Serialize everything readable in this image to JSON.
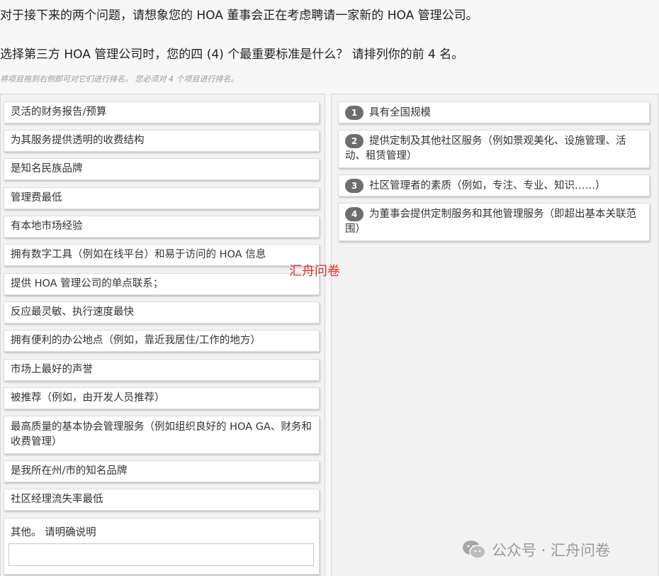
{
  "intro": "对于接下来的两个问题，请想象您的 HOA 董事会正在考虑聘请一家新的 HOA 管理公司。",
  "question": "选择第三方 HOA 管理公司时，您的四 (4) 个最重要标准是什么？   请排列你的前 4 名。",
  "instruction": "将项目拖到右侧即可对它们进行排名。 您必须对 4 个项目进行排名。",
  "available_items": [
    {
      "label": "灵活的财务报告/预算"
    },
    {
      "label": "为其服务提供透明的收费结构"
    },
    {
      "label": "是知名民族品牌"
    },
    {
      "label": "管理费最低"
    },
    {
      "label": "有本地市场经验"
    },
    {
      "label": "拥有数字工具（例如在线平台）和易于访问的 HOA 信息"
    },
    {
      "label": "提供 HOA 管理公司的单点联系；"
    },
    {
      "label": "反应最灵敏、执行速度最快"
    },
    {
      "label": "拥有便利的办公地点（例如，靠近我居住/工作的地方）"
    },
    {
      "label": "市场上最好的声誉"
    },
    {
      "label": "被推荐（例如，由开发人员推荐）"
    },
    {
      "label": "最高质量的基本协会管理服务（例如组织良好的 HOA GA、财务和收费管理）"
    },
    {
      "label": "是我所在州/市的知名品牌"
    },
    {
      "label": "社区经理流失率最低"
    }
  ],
  "other": {
    "label": "其他。 请明确说明",
    "value": ""
  },
  "ranked_items": [
    {
      "rank": "1",
      "label": "具有全国规模"
    },
    {
      "rank": "2",
      "label": "提供定制及其他社区服务（例如景观美化、设施管理、活动、租赁管理）"
    },
    {
      "rank": "3",
      "label": "社区管理者的素质（例如，专注、专业、知识……）"
    },
    {
      "rank": "4",
      "label": "为董事会提供定制服务和其他管理服务（即超出基本关联范围）"
    }
  ],
  "watermark_center": "汇舟问卷",
  "watermark_bottom": "公众号 · 汇舟问卷",
  "colors": {
    "rank_badge": "#6e6e6e",
    "watermark_red": "#e0302a"
  }
}
